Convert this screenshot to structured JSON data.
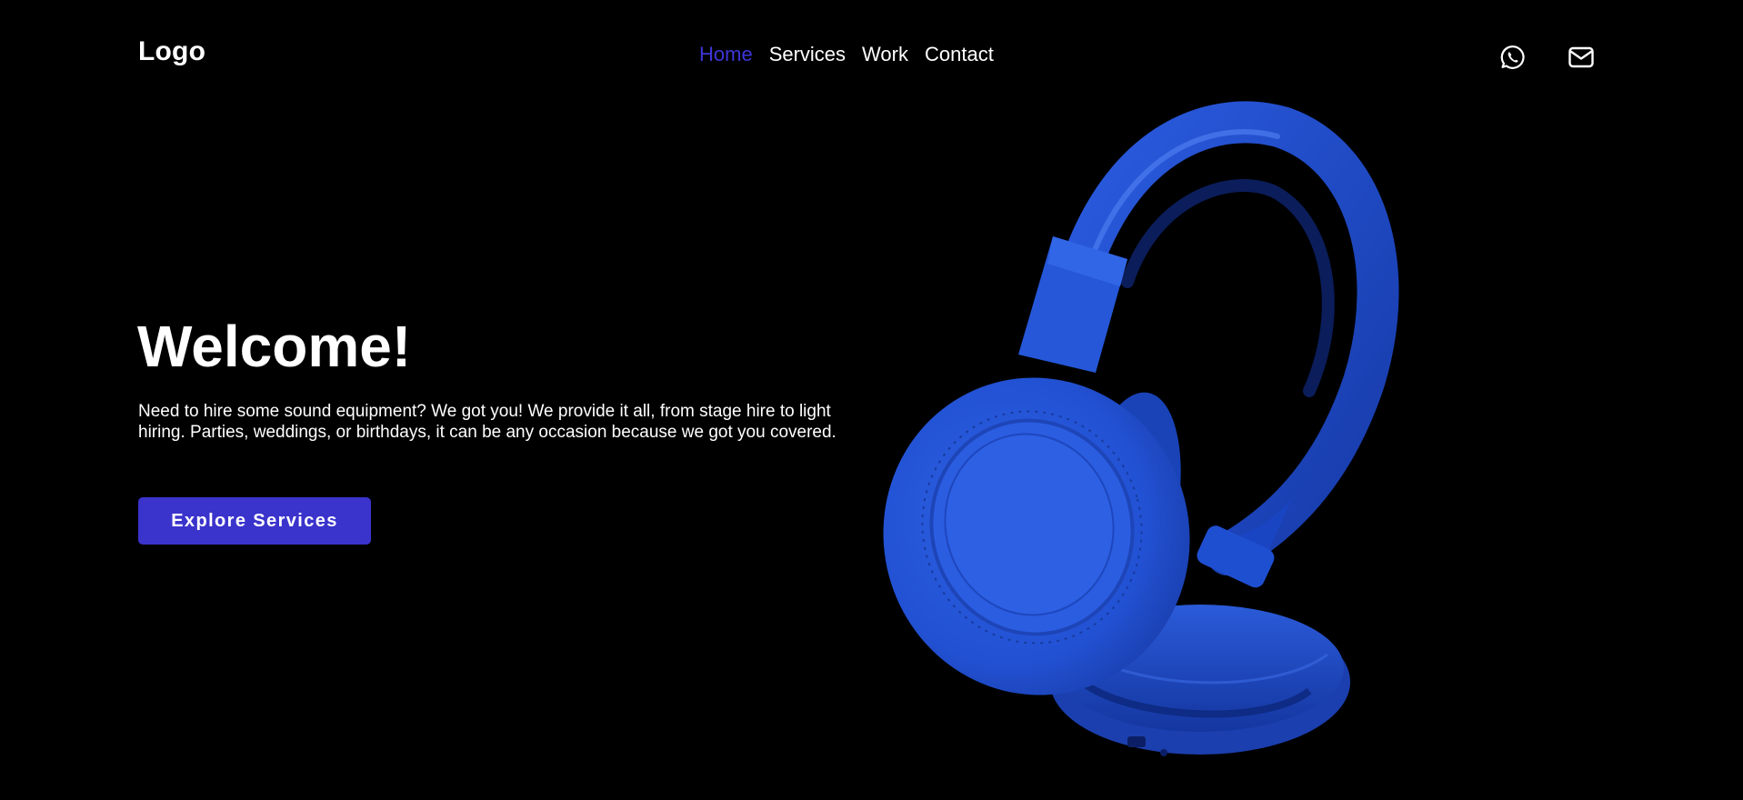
{
  "header": {
    "logo": "Logo",
    "nav": [
      {
        "label": "Home",
        "active": true
      },
      {
        "label": "Services",
        "active": false
      },
      {
        "label": "Work",
        "active": false
      },
      {
        "label": "Contact",
        "active": false
      }
    ],
    "icons": [
      "whatsapp-icon",
      "mail-icon"
    ]
  },
  "hero": {
    "title": "Welcome!",
    "text": "Need to hire some sound equipment? We got you! We provide it all, from stage hire to light hiring. Parties, weddings, or birthdays, it can be any occasion because we got you covered.",
    "cta_label": "Explore Services",
    "image": "blue-headphones"
  },
  "colors": {
    "background": "#000000",
    "accent": "#3a33cc",
    "active_nav": "#3d35d6",
    "text": "#ffffff",
    "headphone_blue": "#1f4fd1"
  }
}
